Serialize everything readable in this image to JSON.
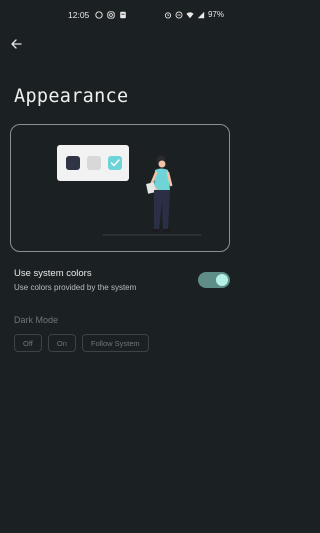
{
  "status_bar": {
    "time": "12:05",
    "battery": "97%"
  },
  "header": {
    "title": "Appearance"
  },
  "settings": {
    "system_colors": {
      "title": "Use system colors",
      "subtitle": "Use colors provided by the system",
      "enabled": true
    },
    "dark_mode": {
      "label": "Dark Mode",
      "options": [
        "Off",
        "On",
        "Follow System"
      ]
    }
  },
  "colors": {
    "background": "#1b2022",
    "accent": "#5e8e86",
    "accent_light": "#b6f0e6",
    "text_primary": "#eaeaea",
    "text_disabled": "#6f7679"
  }
}
